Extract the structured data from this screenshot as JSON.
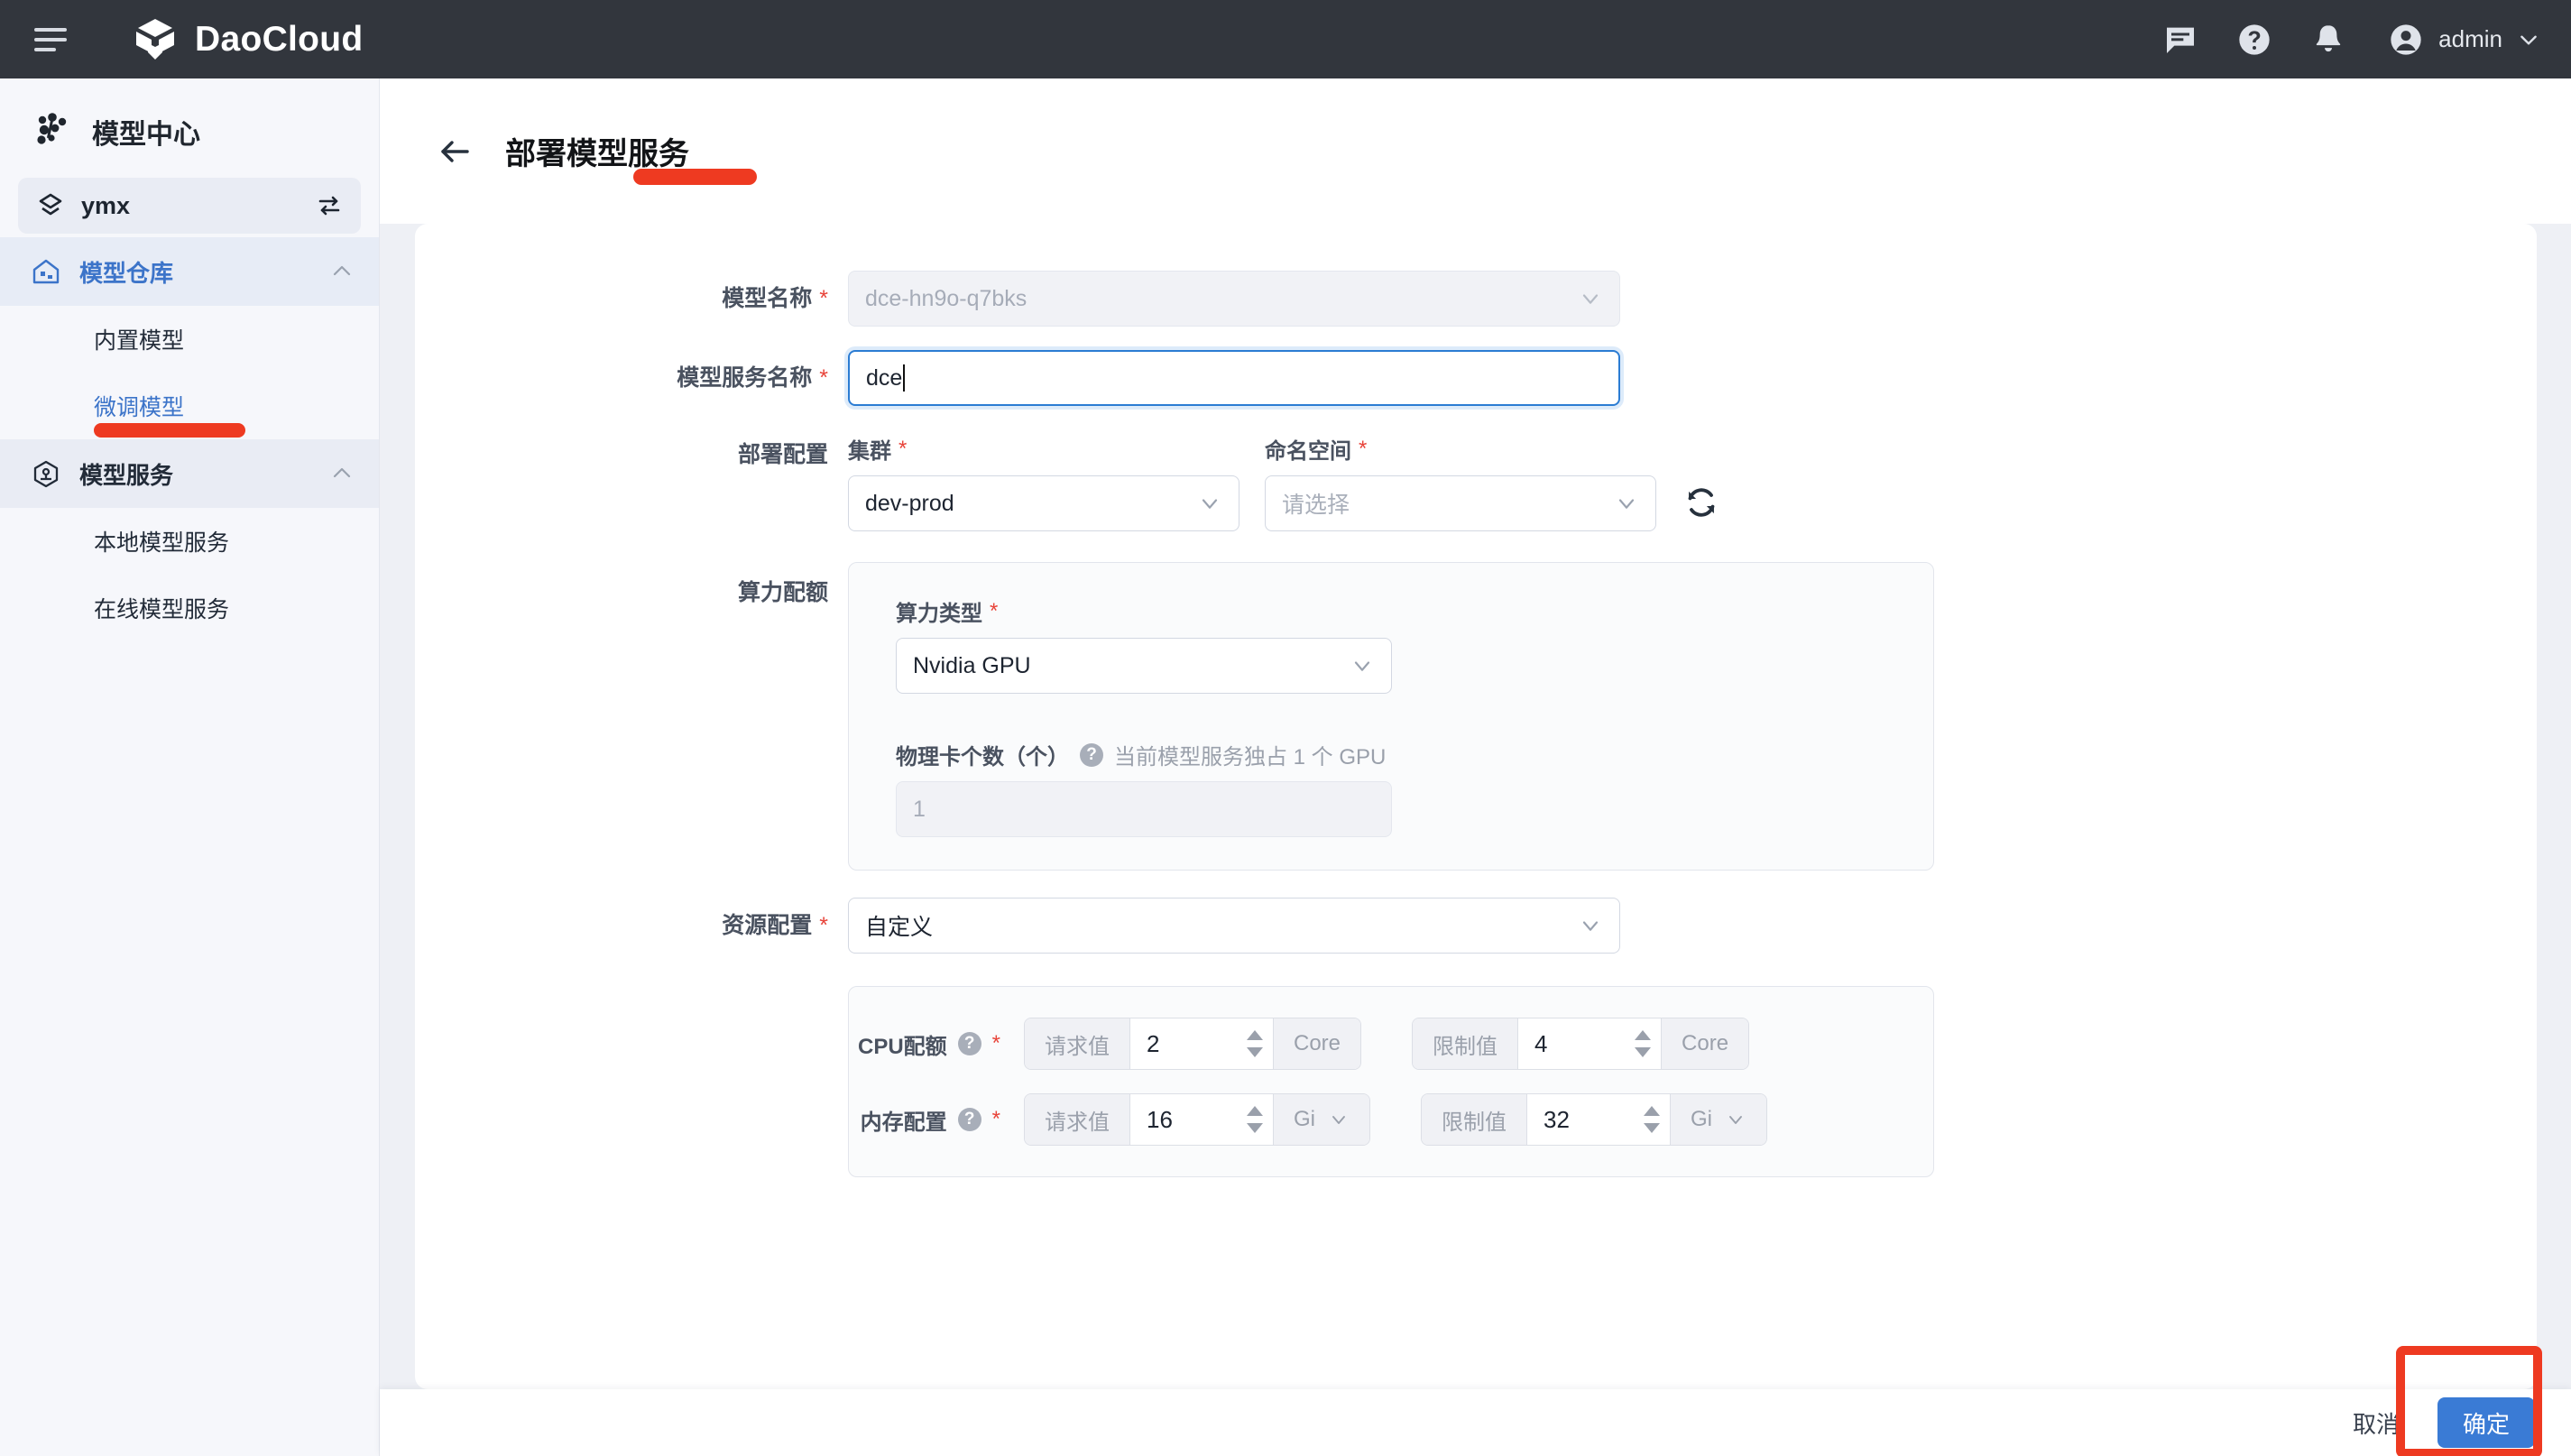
{
  "topbar": {
    "brand_name": "DaoCloud",
    "menu_icon": "hamburger-icon",
    "icons": [
      "message-icon",
      "help-icon",
      "notification-icon"
    ],
    "user_name": "admin"
  },
  "sidebar": {
    "title": "模型中心",
    "workspace": {
      "name": "ymx",
      "icon": "workspace-icon",
      "switch_icon": "swap-icon"
    },
    "groups": [
      {
        "label": "模型仓库",
        "icon": "repository-icon",
        "expanded": true,
        "children": [
          {
            "label": "内置模型",
            "selected": false
          },
          {
            "label": "微调模型",
            "selected": true
          }
        ]
      },
      {
        "label": "模型服务",
        "icon": "model-service-icon",
        "expanded": true,
        "children": [
          {
            "label": "本地模型服务",
            "selected": false
          },
          {
            "label": "在线模型服务",
            "selected": false
          }
        ]
      }
    ]
  },
  "page": {
    "back_icon": "back-arrow-icon",
    "title": "部署模型服务"
  },
  "form": {
    "model_name": {
      "label": "模型名称",
      "required": "*",
      "value": "dce-hn9o-q7bks",
      "disabled": true
    },
    "service_name": {
      "label": "模型服务名称",
      "required": "*",
      "value": "dce",
      "focused": true
    },
    "deploy_config": {
      "label": "部署配置",
      "cluster": {
        "label": "集群",
        "required": "*",
        "value": "dev-prod"
      },
      "namespace": {
        "label": "命名空间",
        "required": "*",
        "placeholder": "请选择",
        "value": ""
      },
      "refresh_icon": "refresh-icon"
    },
    "compute_quota": {
      "label": "算力配额",
      "compute_type": {
        "label": "算力类型",
        "required": "*",
        "value": "Nvidia GPU"
      },
      "card_count": {
        "label": "物理卡个数（个）",
        "help_icon": "question-icon",
        "hint": "当前模型服务独占 1 个 GPU",
        "value": "1",
        "disabled": true
      }
    },
    "resource_config": {
      "label": "资源配置",
      "required": "*",
      "value": "自定义"
    },
    "quota_panel": {
      "cpu": {
        "label": "CPU配额",
        "help_icon": "question-icon",
        "required": "*",
        "request_label": "请求值",
        "request_value": "2",
        "request_unit": "Core",
        "limit_label": "限制值",
        "limit_value": "4",
        "limit_unit": "Core"
      },
      "memory": {
        "label": "内存配置",
        "help_icon": "question-icon",
        "required": "*",
        "request_label": "请求值",
        "request_value": "16",
        "request_unit": "Gi",
        "limit_label": "限制值",
        "limit_value": "32",
        "limit_unit": "Gi"
      }
    }
  },
  "actions": {
    "cancel_label": "取消",
    "confirm_label": "确定"
  },
  "colors": {
    "topbar_bg": "#32363d",
    "accent_blue": "#3a7bd5",
    "sidebar_active_blue": "#3c74c9",
    "annotation_red": "#ee3a21",
    "required_red": "#e8443a",
    "page_bg": "#eef0f5"
  }
}
